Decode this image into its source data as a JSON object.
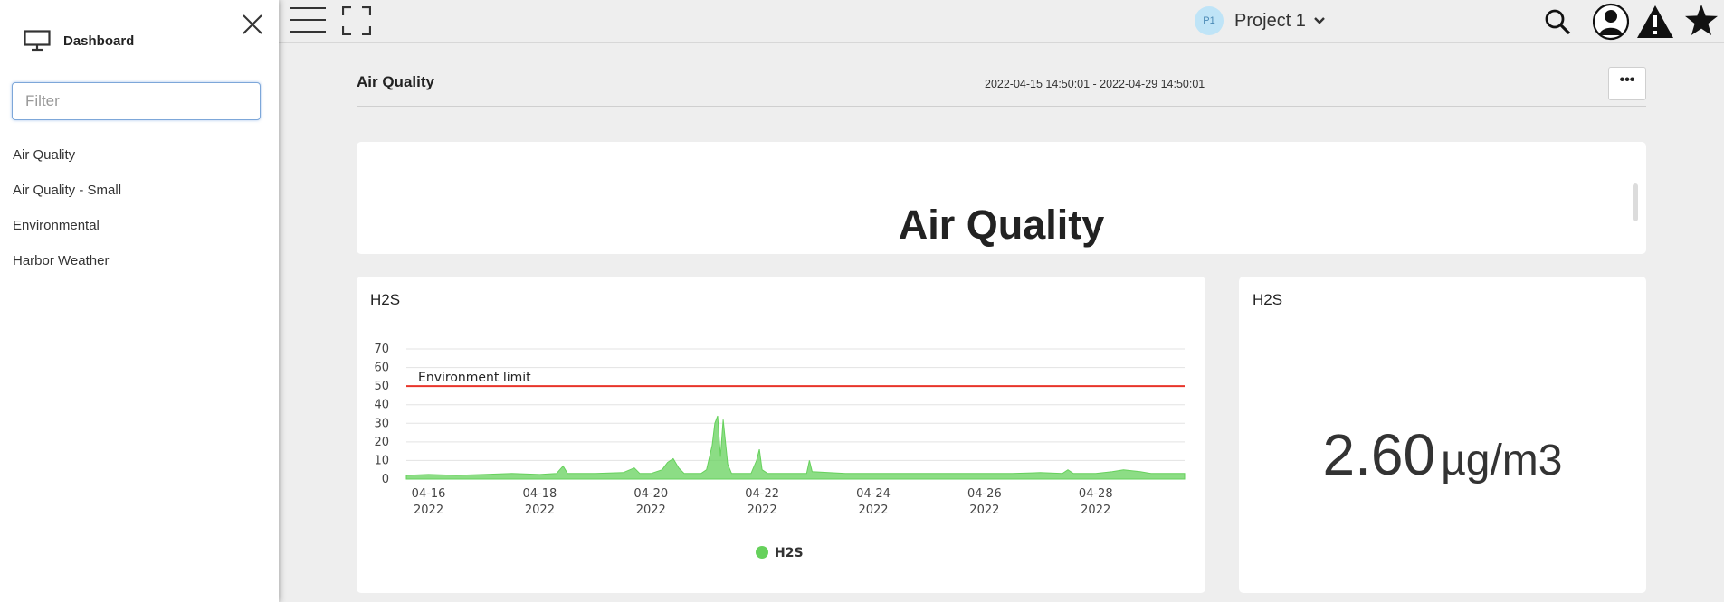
{
  "sidebar": {
    "title": "Dashboard",
    "filter_placeholder": "Filter",
    "items": [
      {
        "label": "Air Quality"
      },
      {
        "label": "Air Quality - Small"
      },
      {
        "label": "Environmental"
      },
      {
        "label": "Harbor Weather"
      }
    ]
  },
  "topbar": {
    "project_badge": "P1",
    "project_name": "Project 1"
  },
  "dashboard": {
    "title": "Air Quality",
    "time_range": "2022-04-15 14:50:01 - 2022-04-29 14:50:01",
    "more_label": "•••"
  },
  "title_panel": {
    "text": "Air Quality"
  },
  "chart_panel": {
    "title": "H2S"
  },
  "stat_panel": {
    "title": "H2S",
    "value": "2.60",
    "unit": "µg/m3"
  },
  "colors": {
    "series": "#66d15c",
    "limit": "#e8342a",
    "accent": "#7da7d9"
  },
  "chart_data": {
    "type": "area",
    "title": "H2S",
    "xlabel": "",
    "ylabel": "",
    "ylim": [
      0,
      70
    ],
    "y_ticks": [
      0,
      10,
      20,
      30,
      40,
      50,
      60,
      70
    ],
    "x_ticks": [
      {
        "line1": "04-16",
        "line2": "2022",
        "day": 16
      },
      {
        "line1": "04-18",
        "line2": "2022",
        "day": 18
      },
      {
        "line1": "04-20",
        "line2": "2022",
        "day": 20
      },
      {
        "line1": "04-22",
        "line2": "2022",
        "day": 22
      },
      {
        "line1": "04-24",
        "line2": "2022",
        "day": 24
      },
      {
        "line1": "04-26",
        "line2": "2022",
        "day": 26
      },
      {
        "line1": "04-28",
        "line2": "2022",
        "day": 28
      }
    ],
    "x_range_days": [
      15.6,
      29.6
    ],
    "threshold": {
      "label": "Environment limit",
      "value": 50
    },
    "legend": "bottom-center",
    "grid": true,
    "series": [
      {
        "name": "H2S",
        "points": [
          [
            15.6,
            2
          ],
          [
            16.0,
            2.5
          ],
          [
            16.5,
            2
          ],
          [
            17.0,
            2.5
          ],
          [
            17.5,
            3
          ],
          [
            18.0,
            2.5
          ],
          [
            18.3,
            3
          ],
          [
            18.42,
            7
          ],
          [
            18.5,
            3
          ],
          [
            19.0,
            3
          ],
          [
            19.5,
            3.5
          ],
          [
            19.7,
            6
          ],
          [
            19.8,
            3
          ],
          [
            20.0,
            3
          ],
          [
            20.2,
            5
          ],
          [
            20.3,
            9
          ],
          [
            20.4,
            11
          ],
          [
            20.5,
            6
          ],
          [
            20.6,
            3
          ],
          [
            20.9,
            3
          ],
          [
            21.0,
            5
          ],
          [
            21.1,
            18
          ],
          [
            21.15,
            30
          ],
          [
            21.2,
            34
          ],
          [
            21.25,
            12
          ],
          [
            21.3,
            32
          ],
          [
            21.38,
            8
          ],
          [
            21.45,
            3
          ],
          [
            21.8,
            3
          ],
          [
            21.9,
            10
          ],
          [
            21.95,
            16
          ],
          [
            22.0,
            5
          ],
          [
            22.1,
            3
          ],
          [
            22.8,
            3
          ],
          [
            22.85,
            10
          ],
          [
            22.9,
            4
          ],
          [
            23.5,
            3
          ],
          [
            24.0,
            3
          ],
          [
            24.5,
            3
          ],
          [
            25.0,
            3
          ],
          [
            25.5,
            3
          ],
          [
            26.0,
            3
          ],
          [
            26.5,
            3
          ],
          [
            27.0,
            3.5
          ],
          [
            27.4,
            3
          ],
          [
            27.5,
            5
          ],
          [
            27.6,
            3
          ],
          [
            28.0,
            3
          ],
          [
            28.3,
            4
          ],
          [
            28.5,
            5
          ],
          [
            28.8,
            4
          ],
          [
            29.0,
            3
          ],
          [
            29.6,
            3
          ]
        ]
      }
    ]
  }
}
